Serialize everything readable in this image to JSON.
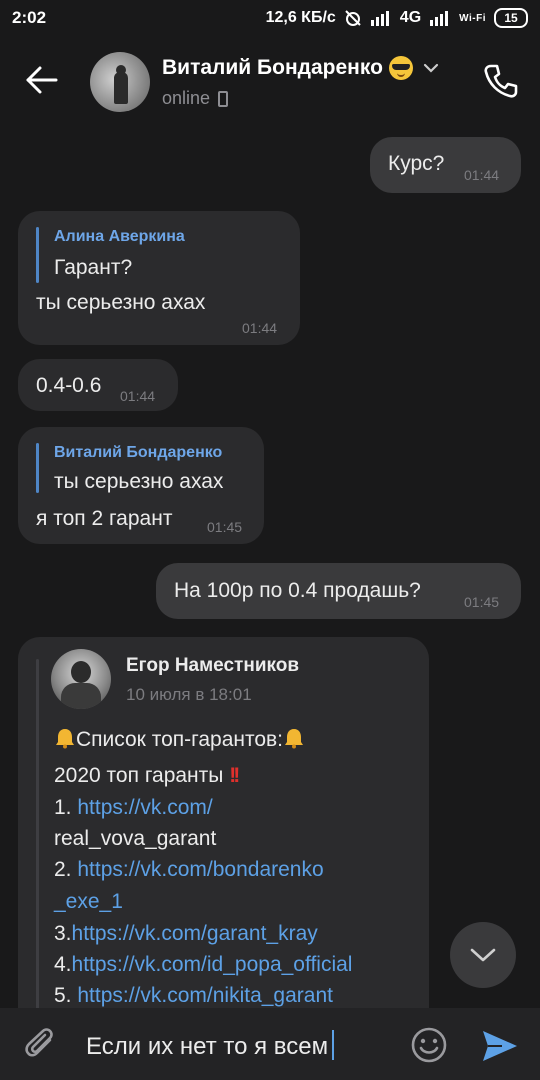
{
  "statusbar": {
    "time": "2:02",
    "net_speed": "12,6 КБ/с",
    "network": "4G",
    "wifi_label": "Wi-Fi",
    "battery": "15"
  },
  "header": {
    "name": "Виталий Бондаренко",
    "status": "online"
  },
  "messages": [
    {
      "dir": "out",
      "text": "Курс?",
      "time": "01:44"
    },
    {
      "dir": "in",
      "reply_name": "Алина Аверкина",
      "reply_text": "Гарант?",
      "text": "ты серьезно ахах",
      "time": "01:44"
    },
    {
      "dir": "in",
      "text": "0.4-0.6",
      "time": "01:44"
    },
    {
      "dir": "in",
      "reply_name": "Виталий Бондаренко",
      "reply_text": "ты серьезно ахах",
      "text": "я топ 2 гарант",
      "time": "01:45"
    },
    {
      "dir": "out",
      "text": "На 100р по 0.4 продашь?",
      "time": "01:45"
    }
  ],
  "forwarded": {
    "author": "Егор Наместников",
    "date": "10 июля в 18:01",
    "title": "Список топ-гарантов:",
    "line2": "2020 топ гаранты",
    "items": [
      {
        "num": "1. ",
        "link": "https://vk.com/",
        "cont": "real_vova_garant"
      },
      {
        "num": "2. ",
        "link": "https://vk.com/bondarenko",
        "cont": "_exe_1"
      },
      {
        "num": "3.",
        "link": "https://vk.com/garant_kray"
      },
      {
        "num": "4.",
        "link": "https://vk.com/id_popa_official"
      },
      {
        "num": "5. ",
        "link": "https://vk.com/nikita_garant"
      }
    ]
  },
  "composer": {
    "text": "Если их нет то я всем"
  },
  "colors": {
    "background": "#19191a",
    "bubble": "#2b2b2d",
    "link": "#5da1e6",
    "reply_name": "#6ea6e8",
    "send": "#5da1e6"
  }
}
